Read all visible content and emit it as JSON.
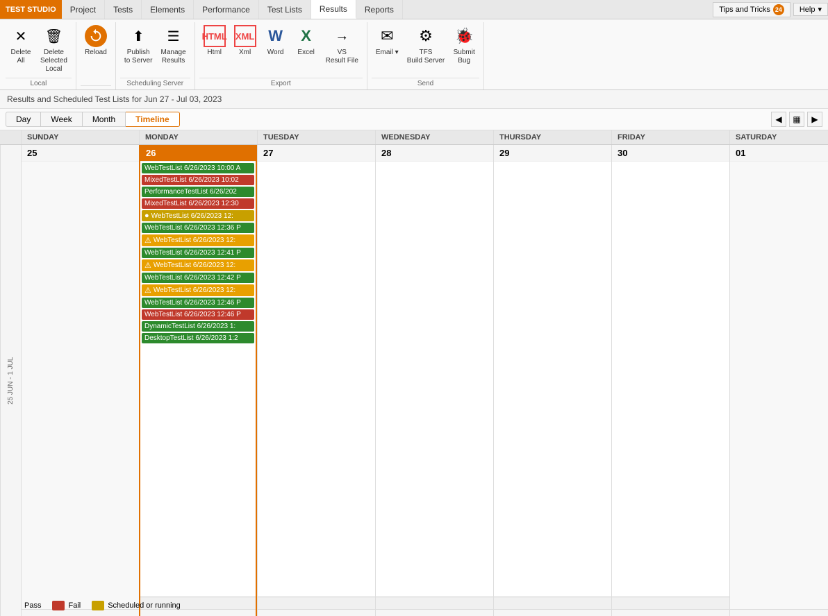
{
  "appTitle": "TEST STUDIO",
  "navTabs": [
    {
      "id": "project",
      "label": "Project",
      "active": false
    },
    {
      "id": "tests",
      "label": "Tests",
      "active": false
    },
    {
      "id": "elements",
      "label": "Elements",
      "active": false
    },
    {
      "id": "performance",
      "label": "Performance",
      "active": false
    },
    {
      "id": "testlists",
      "label": "Test Lists",
      "active": false
    },
    {
      "id": "results",
      "label": "Results",
      "active": true
    },
    {
      "id": "reports",
      "label": "Reports",
      "active": false
    }
  ],
  "topbarRight": {
    "tipsLabel": "Tips and Tricks",
    "tipsCount": "24",
    "helpLabel": "Help"
  },
  "ribbon": {
    "groups": [
      {
        "id": "local",
        "label": "Local",
        "items": [
          {
            "id": "delete-all",
            "label": "Delete\nAll",
            "icon": "✕",
            "type": "btn"
          },
          {
            "id": "delete-selected-local",
            "label": "Delete\nSelected\nLocal",
            "icon": "🗑",
            "type": "btn"
          }
        ]
      },
      {
        "id": "reload",
        "label": "",
        "items": [
          {
            "id": "reload",
            "label": "Reload",
            "icon": "↺",
            "type": "btn",
            "active": true
          }
        ]
      },
      {
        "id": "scheduling",
        "label": "Scheduling Server",
        "items": [
          {
            "id": "publish-to-server",
            "label": "Publish\nto Server",
            "icon": "↑",
            "type": "btn"
          },
          {
            "id": "manage-results",
            "label": "Manage\nResults",
            "icon": "☰",
            "type": "btn"
          }
        ]
      },
      {
        "id": "export",
        "label": "Export",
        "items": [
          {
            "id": "html",
            "label": "Html",
            "icon": "HTML",
            "type": "btn"
          },
          {
            "id": "xml",
            "label": "Xml",
            "icon": "XML",
            "type": "btn"
          },
          {
            "id": "word",
            "label": "Word",
            "icon": "W",
            "type": "btn"
          },
          {
            "id": "excel",
            "label": "Excel",
            "icon": "✕",
            "type": "btn"
          },
          {
            "id": "vs-result-file",
            "label": "VS\nResult File",
            "icon": "→",
            "type": "btn"
          }
        ]
      },
      {
        "id": "send",
        "label": "Send",
        "items": [
          {
            "id": "email",
            "label": "Email",
            "icon": "✉",
            "type": "btn"
          },
          {
            "id": "tfs-build-server",
            "label": "TFS\nBuild Server",
            "icon": "⚙",
            "type": "btn"
          },
          {
            "id": "submit-bug",
            "label": "Submit\nBug",
            "icon": "🐛",
            "type": "btn"
          }
        ]
      }
    ]
  },
  "resultsHeader": "Results and Scheduled Test Lists for Jun 27 - Jul 03, 2023",
  "viewButtons": [
    {
      "id": "day",
      "label": "Day",
      "active": false
    },
    {
      "id": "week",
      "label": "Week",
      "active": false
    },
    {
      "id": "month",
      "label": "Month",
      "active": false
    },
    {
      "id": "timeline",
      "label": "Timeline",
      "active": true
    }
  ],
  "calendar": {
    "weekLabel": "25 JUN - 1 JUL",
    "columns": [
      {
        "day": "SUNDAY",
        "date": "25",
        "today": false,
        "weekend": true,
        "events": []
      },
      {
        "day": "MONDAY",
        "date": "26",
        "today": true,
        "weekend": false,
        "events": [
          {
            "label": "WebTestList 6/26/2023 10:00 A",
            "type": "pass",
            "icon": ""
          },
          {
            "label": "MixedTestList 6/26/2023 10:02",
            "type": "fail",
            "icon": ""
          },
          {
            "label": "PerformanceTestList 6/26/202",
            "type": "pass",
            "icon": ""
          },
          {
            "label": "MixedTestList 6/26/2023 12:30",
            "type": "fail",
            "icon": ""
          },
          {
            "label": "WebTestList 6/26/2023 12:",
            "type": "running",
            "icon": "●"
          },
          {
            "label": "WebTestList 6/26/2023 12:36 P",
            "type": "pass",
            "icon": ""
          },
          {
            "label": "WebTestList 6/26/2023 12:",
            "type": "warn",
            "icon": "⚠"
          },
          {
            "label": "WebTestList 6/26/2023 12:41 P",
            "type": "pass",
            "icon": ""
          },
          {
            "label": "WebTestList 6/26/2023 12:",
            "type": "warn",
            "icon": "⚠"
          },
          {
            "label": "WebTestList 6/26/2023 12:42 P",
            "type": "pass",
            "icon": ""
          },
          {
            "label": "WebTestList 6/26/2023 12:",
            "type": "warn",
            "icon": "⚠"
          },
          {
            "label": "WebTestList 6/26/2023 12:46 P",
            "type": "pass",
            "icon": ""
          },
          {
            "label": "WebTestList 6/26/2023 12:46 P",
            "type": "fail",
            "icon": ""
          },
          {
            "label": "DynamicTestList 6/26/2023 1:",
            "type": "pass",
            "icon": ""
          },
          {
            "label": "DesktopTestList 6/26/2023 1:2",
            "type": "pass",
            "icon": ""
          }
        ]
      },
      {
        "day": "TUESDAY",
        "date": "27",
        "today": false,
        "weekend": false,
        "events": []
      },
      {
        "day": "WEDNESDAY",
        "date": "28",
        "today": false,
        "weekend": false,
        "events": []
      },
      {
        "day": "THURSDAY",
        "date": "29",
        "today": false,
        "weekend": false,
        "events": []
      },
      {
        "day": "FRIDAY",
        "date": "30",
        "today": false,
        "weekend": false,
        "events": []
      },
      {
        "day": "SATURDAY",
        "date": "01",
        "today": false,
        "weekend": true,
        "events": []
      }
    ]
  },
  "legend": [
    {
      "label": "Pass",
      "type": "pass"
    },
    {
      "label": "Fail",
      "type": "fail"
    },
    {
      "label": "Scheduled or running",
      "type": "scheduled"
    }
  ]
}
